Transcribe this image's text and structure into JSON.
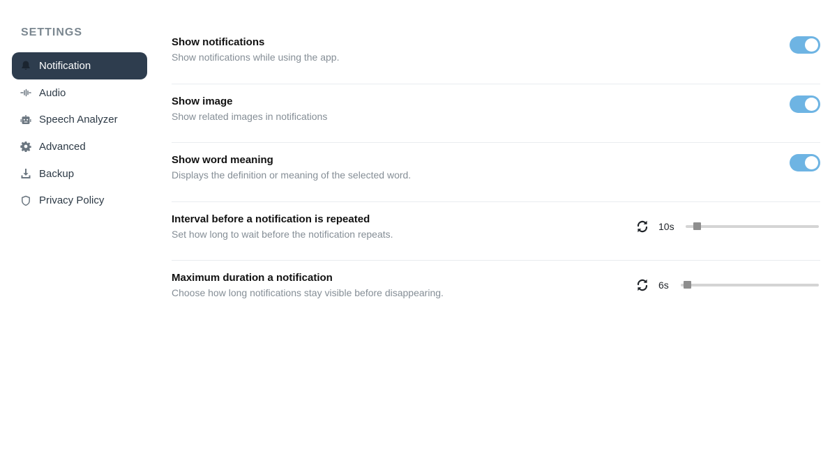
{
  "sidebar": {
    "title": "SETTINGS",
    "items": [
      {
        "label": "Notification",
        "icon": "bell-icon",
        "active": true
      },
      {
        "label": "Audio",
        "icon": "audio-wave-icon",
        "active": false
      },
      {
        "label": "Speech Analyzer",
        "icon": "robot-icon",
        "active": false
      },
      {
        "label": "Advanced",
        "icon": "gear-icon",
        "active": false
      },
      {
        "label": "Backup",
        "icon": "download-icon",
        "active": false
      },
      {
        "label": "Privacy Policy",
        "icon": "shield-icon",
        "active": false
      }
    ]
  },
  "settings": {
    "show_notifications": {
      "title": "Show notifications",
      "description": "Show notifications while using the app.",
      "enabled": true
    },
    "show_image": {
      "title": "Show image",
      "description": "Show related images in notifications",
      "enabled": true
    },
    "show_word_meaning": {
      "title": "Show word meaning",
      "description": "Displays the definition or meaning of the selected word.",
      "enabled": true
    },
    "repeat_interval": {
      "title": "Interval before a notification is repeated",
      "description": "Set how long to wait before the notification repeats.",
      "value_label": "10s",
      "level": 0.06
    },
    "max_duration": {
      "title": "Maximum duration a notification",
      "description": "Choose how long notifications stay visible before disappearing.",
      "value_label": "6s",
      "level": 0.02
    }
  },
  "colors": {
    "accent": "#6eb4e3",
    "active_nav": "#2e3d4e",
    "slider_track": "#d4d4d4",
    "slider_thumb": "#8e8e8e"
  }
}
